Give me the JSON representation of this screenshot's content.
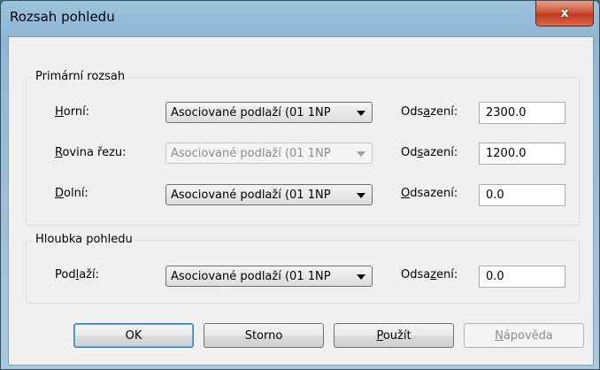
{
  "window": {
    "title": "Rozsah pohledu",
    "close_glyph": "x"
  },
  "primary_range": {
    "legend": "Primární rozsah",
    "rows": [
      {
        "label_pre": "",
        "label_key": "H",
        "label_post": "orní:",
        "combo_value": "Asociované podlaží (01 1NP",
        "combo_enabled": true,
        "offset_pre": "Ods",
        "offset_key": "a",
        "offset_post": "zení:",
        "offset_value": "2300.0"
      },
      {
        "label_pre": "",
        "label_key": "R",
        "label_post": "ovina řezu:",
        "combo_value": "Asociované podlaží (01 1NP",
        "combo_enabled": false,
        "offset_pre": "Od",
        "offset_key": "s",
        "offset_post": "azení:",
        "offset_value": "1200.0"
      },
      {
        "label_pre": "",
        "label_key": "D",
        "label_post": "olní:",
        "combo_value": "Asociované podlaží (01 1NP",
        "combo_enabled": true,
        "offset_pre": "",
        "offset_key": "O",
        "offset_post": "dsazení:",
        "offset_value": "0.0"
      }
    ]
  },
  "view_depth": {
    "legend": "Hloubka pohledu",
    "row": {
      "label_pre": "Pod",
      "label_key": "l",
      "label_post": "aží:",
      "combo_value": "Asociované podlaží (01 1NP",
      "offset_pre": "Odsa",
      "offset_key": "z",
      "offset_post": "ení:",
      "offset_value": "0.0"
    }
  },
  "buttons": {
    "ok": "OK",
    "cancel": "Storno",
    "apply_key": "P",
    "apply_rest": "oužít",
    "help_key": "N",
    "help_rest": "ápověda"
  }
}
